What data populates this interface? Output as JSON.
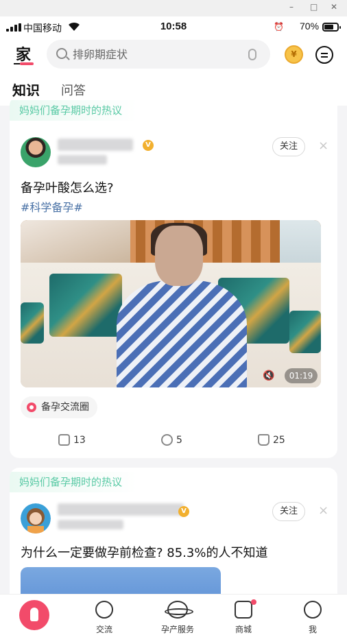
{
  "window": {
    "minimize": "–",
    "maximize": "□",
    "close": "✕"
  },
  "statusbar": {
    "carrier": "中国移动",
    "time": "10:58",
    "battery": "70%",
    "battery_level": 0.7
  },
  "header": {
    "logo": "家",
    "search_placeholder": "排卵期症状",
    "coin_symbol": "¥",
    "tabs": [
      {
        "label": "知识",
        "active": true
      },
      {
        "label": "问答",
        "active": false
      }
    ]
  },
  "feed": [
    {
      "section": "妈妈们备孕期时的热议",
      "follow_label": "关注",
      "close_symbol": "×",
      "title": "备孕叶酸怎么选?",
      "hashtag": "#科学备孕#",
      "video": {
        "duration": "01:19",
        "muted": true
      },
      "circle": "备孕交流圈",
      "stats": {
        "shares": "13",
        "comments": "5",
        "likes": "25"
      }
    },
    {
      "section": "妈妈们备孕期时的热议",
      "follow_label": "关注",
      "close_symbol": "×",
      "title": "为什么一定要做孕前检查? 85.3%的人不知道"
    }
  ],
  "bottom_nav": [
    {
      "label": "",
      "icon": "rocket-icon"
    },
    {
      "label": "交流",
      "icon": "chat-face-icon"
    },
    {
      "label": "孕产服务",
      "icon": "planet-icon"
    },
    {
      "label": "商城",
      "icon": "shopping-bag-icon",
      "badge_dot": true
    },
    {
      "label": "我",
      "icon": "smile-face-icon"
    }
  ],
  "colors": {
    "accent": "#f24b6a",
    "hot_topic": "#58c9a4",
    "hashtag": "#4a72a6"
  }
}
